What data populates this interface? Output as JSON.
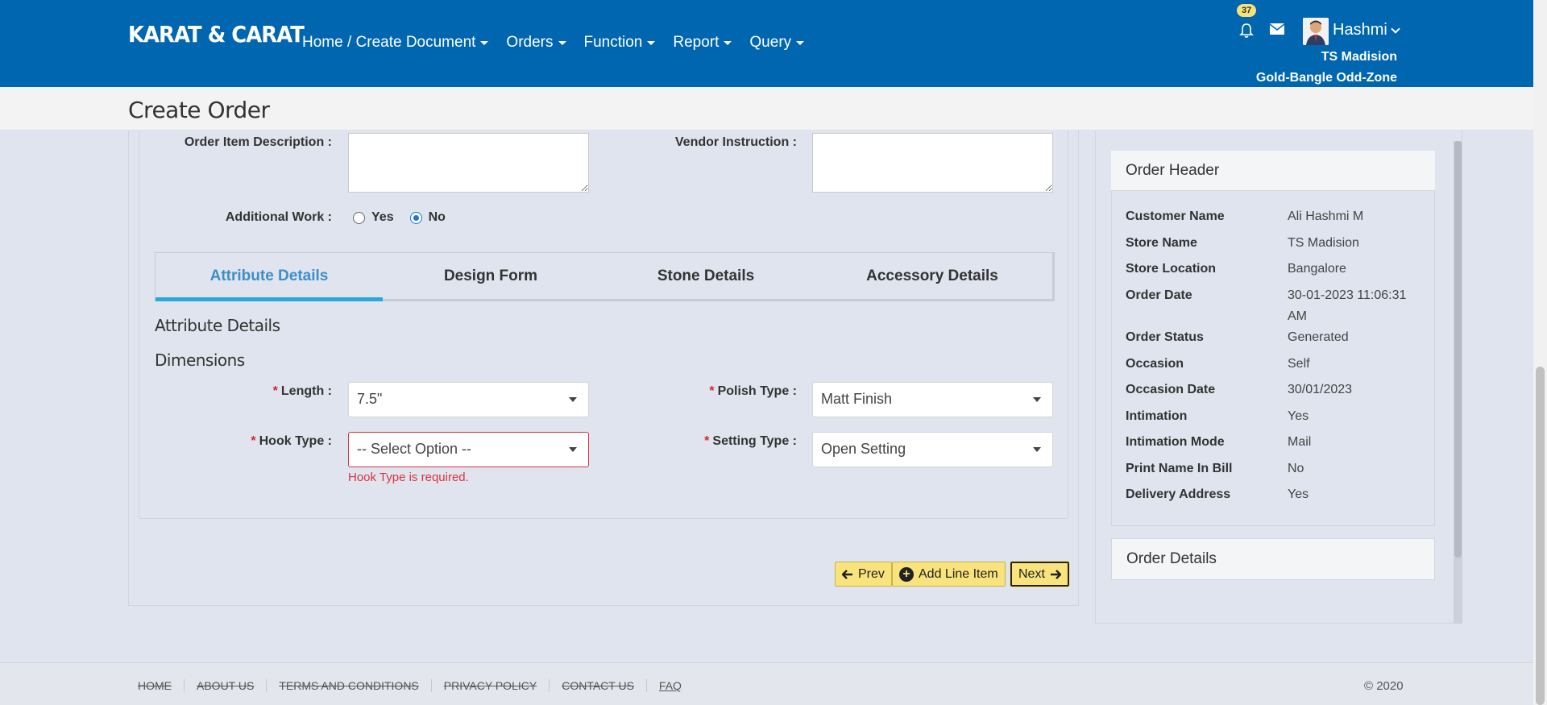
{
  "header": {
    "brand": "KARAT & CARAT",
    "nav": [
      {
        "label": "Home / Create Document"
      },
      {
        "label": "Orders"
      },
      {
        "label": "Function"
      },
      {
        "label": "Report"
      },
      {
        "label": "Query"
      }
    ],
    "notification_count": "37",
    "user_name": "Hashmi",
    "store_name": "TS Madision",
    "store_zone": "Gold-Bangle Odd-Zone"
  },
  "page": {
    "title": "Create Order"
  },
  "form": {
    "order_item_description_label": "Order Item Description :",
    "vendor_instruction_label": "Vendor Instruction :",
    "additional_work_label": "Additional Work :",
    "radio_yes": "Yes",
    "radio_no": "No",
    "additional_work_value": "No"
  },
  "tabs": [
    {
      "label": "Attribute Details",
      "active": true
    },
    {
      "label": "Design Form",
      "active": false
    },
    {
      "label": "Stone Details",
      "active": false
    },
    {
      "label": "Accessory Details",
      "active": false
    }
  ],
  "attributes": {
    "section_title": "Attribute Details",
    "subsection_title": "Dimensions",
    "required_mark": "*",
    "length_label": "Length :",
    "length_value": "7.5\"",
    "polish_type_label": "Polish Type :",
    "polish_type_value": "Matt Finish",
    "hook_type_label": "Hook Type :",
    "hook_type_value": "-- Select Option --",
    "hook_type_error": "Hook Type is required.",
    "setting_type_label": "Setting Type :",
    "setting_type_value": "Open Setting"
  },
  "buttons": {
    "prev": "Prev",
    "add_line_item": "Add Line Item",
    "next": "Next"
  },
  "order_header": {
    "title": "Order Header",
    "rows": [
      {
        "key": "Customer Name",
        "value": "Ali Hashmi M"
      },
      {
        "key": "Store Name",
        "value": "TS Madision"
      },
      {
        "key": "Store Location",
        "value": "Bangalore"
      },
      {
        "key": "Order Date",
        "value": "30-01-2023 11:06:31 AM"
      },
      {
        "key": "Order Status",
        "value": "Generated"
      },
      {
        "key": "Occasion",
        "value": "Self"
      },
      {
        "key": "Occasion Date",
        "value": "30/01/2023"
      },
      {
        "key": "Intimation",
        "value": "Yes"
      },
      {
        "key": "Intimation Mode",
        "value": "Mail"
      },
      {
        "key": "Print Name In Bill",
        "value": "No"
      },
      {
        "key": "Delivery Address",
        "value": "Yes"
      }
    ]
  },
  "order_details": {
    "title": "Order Details"
  },
  "footer": {
    "links": [
      "HOME",
      "ABOUT US",
      "TERMS AND CONDITIONS",
      "PRIVACY POLICY",
      "CONTACT US",
      "FAQ"
    ],
    "copyright": "© 2020"
  },
  "colors": {
    "navbar": "#0066b0",
    "accent_button": "#f8e37c",
    "error": "#e0323a",
    "active_tab": "#3d8ec9"
  }
}
